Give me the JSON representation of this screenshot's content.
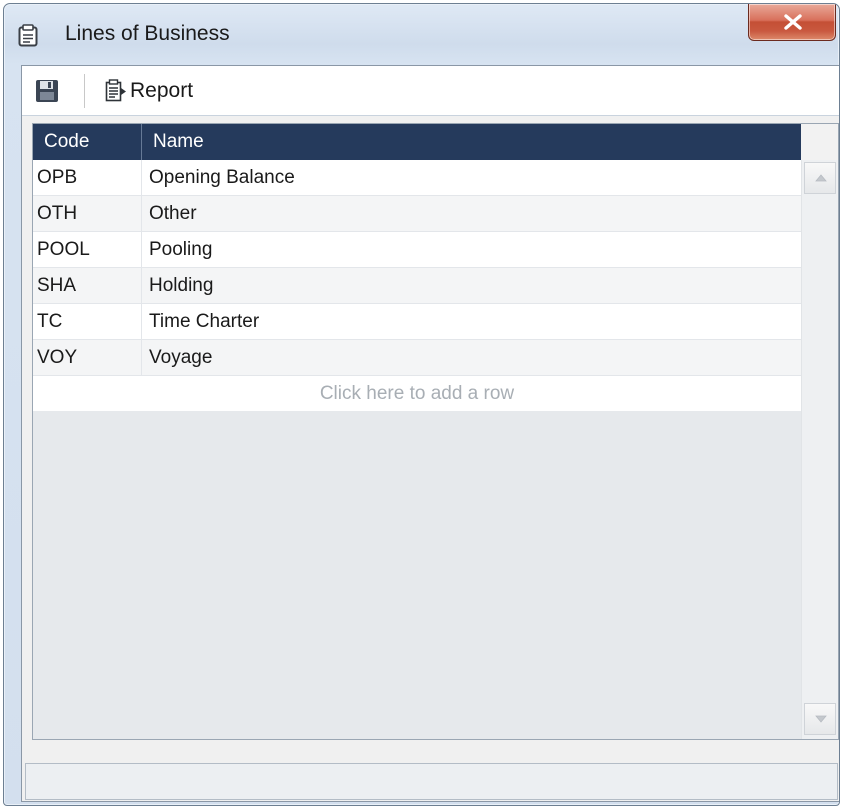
{
  "window": {
    "title": "Lines of Business",
    "icons": {
      "title": "document-list-icon",
      "close": "close-icon"
    }
  },
  "toolbar": {
    "save_icon": "floppy-disk-icon",
    "report_icon": "report-document-icon",
    "report_label": "Report"
  },
  "grid": {
    "columns": {
      "code": "Code",
      "name": "Name"
    },
    "rows": [
      {
        "code": "OPB",
        "name": "Opening Balance"
      },
      {
        "code": "OTH",
        "name": "Other"
      },
      {
        "code": "POOL",
        "name": "Pooling"
      },
      {
        "code": "SHA",
        "name": "Holding"
      },
      {
        "code": "TC",
        "name": "Time Charter"
      },
      {
        "code": "VOY",
        "name": "Voyage"
      }
    ],
    "add_row_text": "Click here to add a row"
  },
  "colors": {
    "header_bg": "#253a5c",
    "close_button": "#c9583f",
    "window_frame": "#d3dfee"
  }
}
